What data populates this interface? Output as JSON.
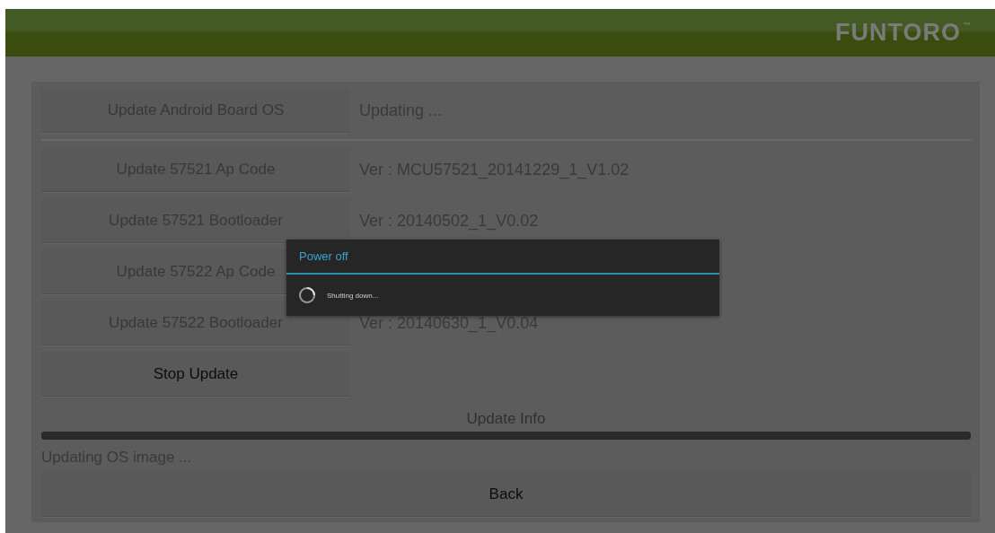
{
  "header": {
    "logo": "FUNTORO",
    "trademark": "™"
  },
  "update_rows": [
    {
      "button": "Update Android Board OS",
      "disabled": true,
      "status": "Updating ...",
      "divider_after": true
    },
    {
      "button": "Update 57521 Ap Code",
      "disabled": true,
      "status": "Ver : MCU57521_20141229_1_V1.02",
      "divider_after": false
    },
    {
      "button": "Update 57521 Bootloader",
      "disabled": true,
      "status": "Ver : 20140502_1_V0.02",
      "divider_after": false
    },
    {
      "button": "Update 57522 Ap Code",
      "disabled": true,
      "divider_after": false
    },
    {
      "button": "Update 57522 Bootloader",
      "disabled": true,
      "status": "Ver : 20140630_1_V0.04",
      "divider_after": false
    }
  ],
  "stop_button": {
    "label": "Stop Update",
    "disabled": false
  },
  "update_info": {
    "title": "Update Info",
    "level": 1,
    "message": "Updating OS image ..."
  },
  "back_button": {
    "label": "Back",
    "disabled": false
  },
  "dialog": {
    "title": "Power off",
    "message": "Shutting down..."
  }
}
